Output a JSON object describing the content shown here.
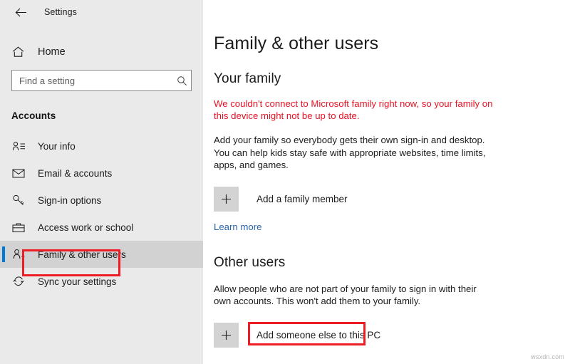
{
  "window": {
    "back_icon": "back-arrow-icon",
    "title": "Settings"
  },
  "sidebar": {
    "home": {
      "label": "Home",
      "icon": "home-icon"
    },
    "search": {
      "placeholder": "Find a setting",
      "value": "",
      "icon": "search-icon"
    },
    "section_title": "Accounts",
    "items": [
      {
        "label": "Your info",
        "icon": "user-info-icon",
        "selected": false
      },
      {
        "label": "Email & accounts",
        "icon": "envelope-icon",
        "selected": false
      },
      {
        "label": "Sign-in options",
        "icon": "key-icon",
        "selected": false
      },
      {
        "label": "Access work or school",
        "icon": "briefcase-icon",
        "selected": false
      },
      {
        "label": "Family & other users",
        "icon": "user-plus-icon",
        "selected": true
      },
      {
        "label": "Sync your settings",
        "icon": "sync-icon",
        "selected": false
      }
    ],
    "accent_color": "#0078d7",
    "selected_bg": "#d2d2d2"
  },
  "main": {
    "page_title": "Family & other users",
    "your_family": {
      "heading": "Your family",
      "error": "We couldn't connect to Microsoft family right now, so your family on this device might not be up to date.",
      "description": "Add your family so everybody gets their own sign-in and desktop. You can help kids stay safe with appropriate websites, time limits, apps, and games.",
      "add_button": {
        "label": "Add a family member",
        "icon": "plus-icon"
      },
      "learn_more": "Learn more"
    },
    "other_users": {
      "heading": "Other users",
      "description": "Allow people who are not part of your family to sign in with their own accounts. This won't add them to your family.",
      "add_button": {
        "label": "Add someone else to this PC",
        "icon": "plus-icon"
      }
    }
  },
  "annotations": {
    "highlight_color": "#ee1c25",
    "targets": [
      "Family & other users",
      "Add someone else to this PC"
    ]
  },
  "watermark": "wsxdn.com"
}
